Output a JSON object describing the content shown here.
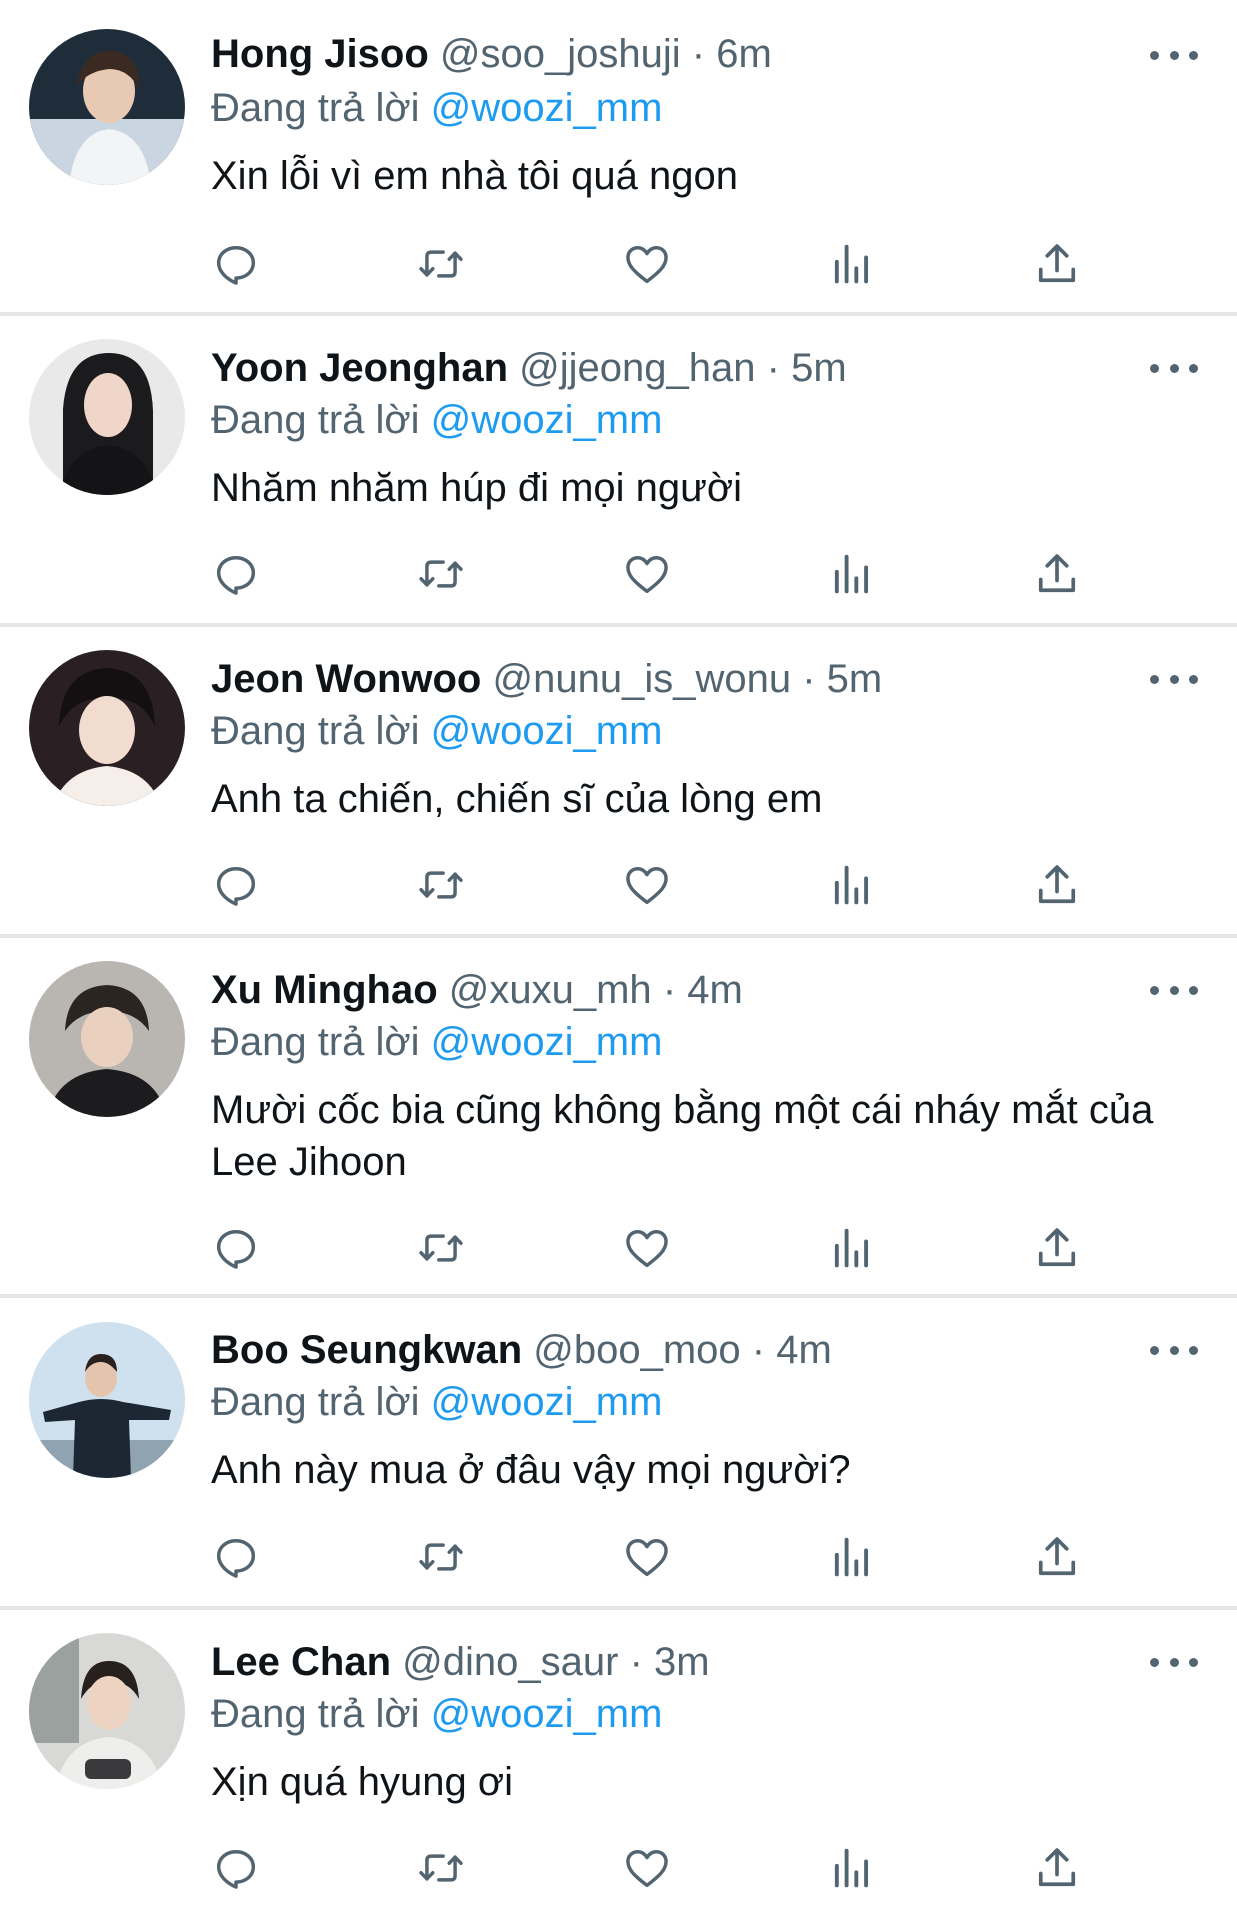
{
  "reply_prefix": "Đang trả lời",
  "colors": {
    "text": "#0f1419",
    "secondary": "#536471",
    "accent": "#1d9bf0",
    "divider": "#e4e6e8"
  },
  "actions": [
    "reply-icon",
    "retweet-icon",
    "like-icon",
    "views-icon",
    "share-icon"
  ],
  "tweets": [
    {
      "name": "Hong Jisoo",
      "handle": "@soo_joshuji",
      "dot": "·",
      "time": "6m",
      "reply_to": "@woozi_mm",
      "text": "Xin lỗi vì em nhà tôi quá ngon"
    },
    {
      "name": "Yoon Jeonghan",
      "handle": "@jjeong_han",
      "dot": "·",
      "time": "5m",
      "reply_to": "@woozi_mm",
      "text": "Nhăm nhăm húp đi mọi người"
    },
    {
      "name": "Jeon Wonwoo",
      "handle": "@nunu_is_wonu",
      "dot": "·",
      "time": "5m",
      "reply_to": "@woozi_mm",
      "text": "Anh ta chiến, chiến sĩ của lòng em"
    },
    {
      "name": "Xu Minghao",
      "handle": "@xuxu_mh",
      "dot": "·",
      "time": "4m",
      "reply_to": "@woozi_mm",
      "text": "Mười cốc bia cũng không bằng một cái nháy mắt của Lee Jihoon"
    },
    {
      "name": "Boo Seungkwan",
      "handle": "@boo_moo",
      "dot": "·",
      "time": "4m",
      "reply_to": "@woozi_mm",
      "text": "Anh này mua ở đâu vậy mọi người?"
    },
    {
      "name": "Lee Chan",
      "handle": "@dino_saur",
      "dot": "·",
      "time": "3m",
      "reply_to": "@woozi_mm",
      "text": "Xịn quá hyung ơi"
    }
  ]
}
